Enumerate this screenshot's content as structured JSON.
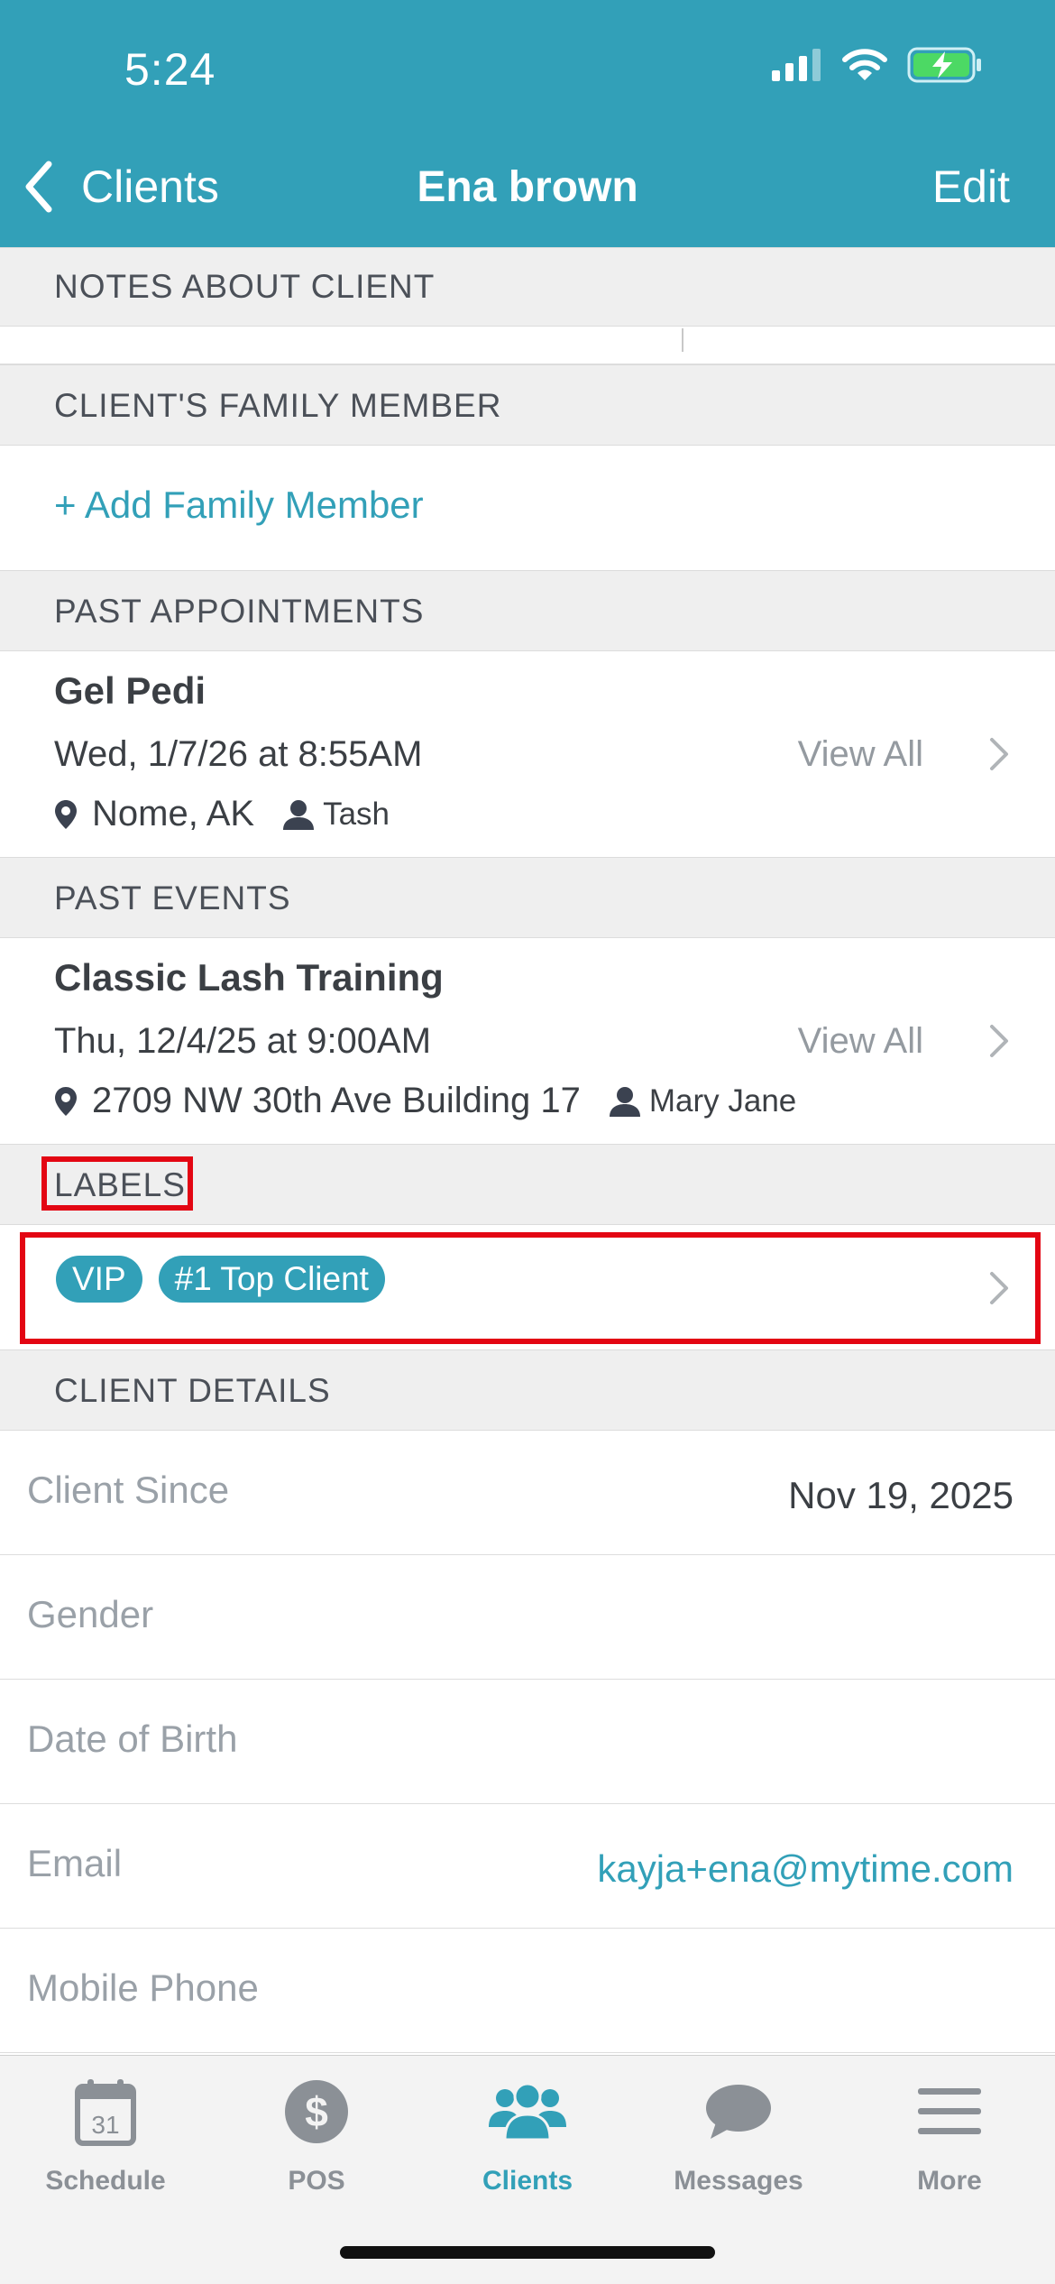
{
  "status_bar": {
    "time": "5:24"
  },
  "nav": {
    "back_label": "Clients",
    "title": "Ena brown",
    "edit_label": "Edit"
  },
  "sections": {
    "notes": "NOTES ABOUT CLIENT",
    "family": "CLIENT'S FAMILY MEMBER",
    "past_appointments": "PAST APPOINTMENTS",
    "past_events": "PAST EVENTS",
    "labels": "LABELS",
    "client_details": "CLIENT DETAILS"
  },
  "family": {
    "add_label": "+ Add Family Member"
  },
  "past_appointment": {
    "title": "Gel Pedi",
    "datetime": "Wed, 1/7/26 at 8:55AM",
    "location": "Nome, AK",
    "staff": "Tash",
    "view_all": "View All"
  },
  "past_event": {
    "title": "Classic Lash Training",
    "datetime": "Thu, 12/4/25 at 9:00AM",
    "location": "2709 NW 30th Ave Building 17",
    "staff": "Mary Jane",
    "view_all": "View All"
  },
  "labels": [
    "VIP",
    "#1 Top Client"
  ],
  "client_details": [
    {
      "label": "Client Since",
      "value": "Nov 19, 2025"
    },
    {
      "label": "Gender",
      "value": ""
    },
    {
      "label": "Date of Birth",
      "value": ""
    },
    {
      "label": "Email",
      "value": "kayja+ena@mytime.com"
    },
    {
      "label": "Mobile Phone",
      "value": ""
    }
  ],
  "tabs": [
    {
      "label": "Schedule",
      "icon": "calendar-icon",
      "calendar_day": "31"
    },
    {
      "label": "POS",
      "icon": "dollar-icon"
    },
    {
      "label": "Clients",
      "icon": "clients-icon"
    },
    {
      "label": "Messages",
      "icon": "chat-bubble-icon"
    },
    {
      "label": "More",
      "icon": "menu-icon"
    }
  ],
  "colors": {
    "brand": "#32a0b8",
    "highlight": "#e30613",
    "section_bg": "#efefef"
  }
}
